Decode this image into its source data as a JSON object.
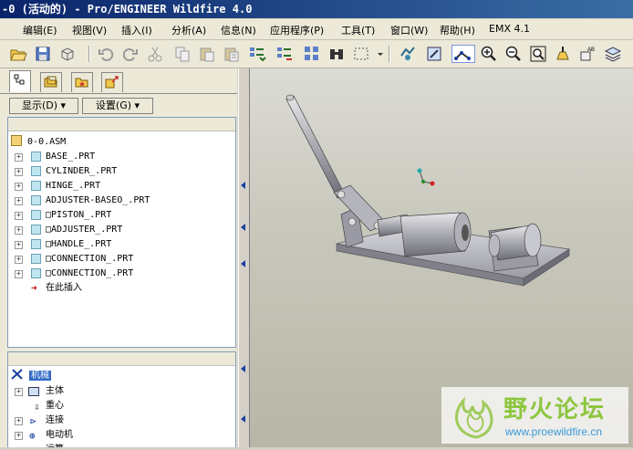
{
  "window": {
    "title": "-0 (活动的) - Pro/ENGINEER Wildfire 4.0"
  },
  "menu": {
    "items": [
      "编辑(E)",
      "视图(V)",
      "插入(I)",
      "分析(A)",
      "信息(N)",
      "应用程序(P)",
      "工具(T)",
      "窗口(W)",
      "帮助(H)",
      "EMX 4.1"
    ]
  },
  "toolbar": {
    "icons": [
      "open-icon",
      "save-icon",
      "undo-icon",
      "redo-icon",
      "cut-icon",
      "copy-icon",
      "paste-icon",
      "paste-special-icon",
      "regenerate-icon",
      "regen-manager-icon",
      "find-icon",
      "binoculars-icon",
      "select-box-icon",
      "select-dropdown-icon",
      "spin-center-icon",
      "orient-icon",
      "connection-icon",
      "zoom-in-icon",
      "zoom-out-icon",
      "refit-icon",
      "repaint-icon",
      "named-views-icon",
      "layers-icon"
    ]
  },
  "left_panel": {
    "display_button": "显示(D)",
    "settings_button": "设置(G)",
    "model_tree": {
      "root": "0-0.ASM",
      "items": [
        "BASE_.PRT",
        "CYLINDER_.PRT",
        "HINGE_.PRT",
        "ADJUSTER-BASEO_.PRT",
        "□PISTON_.PRT",
        "□ADJUSTER_.PRT",
        "□HANDLE_.PRT",
        "□CONNECTION_.PRT",
        "□CONNECTION_.PRT"
      ],
      "insert_here": "在此插入"
    },
    "mechanism_tree": {
      "root": "机械",
      "items": [
        "主体",
        "重心",
        "连接",
        "电动机",
        "运算"
      ]
    }
  },
  "watermark": {
    "title": "野火论坛",
    "url": "www.proewildfire.cn"
  },
  "colors": {
    "title_bar": "#0a246a",
    "viewport_top": "#dcdcd6",
    "viewport_bottom": "#b8b6a6",
    "watermark_green": "#8dc63f"
  }
}
